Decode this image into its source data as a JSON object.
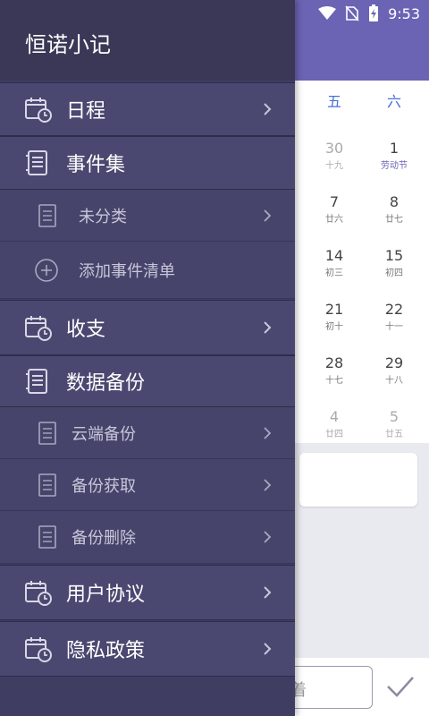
{
  "status": {
    "time": "9:53"
  },
  "calendar": {
    "weekdays": [
      "五",
      "六"
    ],
    "rows": [
      [
        {
          "d": "30",
          "l": "十九"
        },
        {
          "d": "1",
          "l": "劳动节"
        }
      ],
      [
        {
          "d": "7",
          "l": "廿六"
        },
        {
          "d": "8",
          "l": "廿七"
        }
      ],
      [
        {
          "d": "14",
          "l": "初三"
        },
        {
          "d": "15",
          "l": "初四"
        }
      ],
      [
        {
          "d": "21",
          "l": "初十"
        },
        {
          "d": "22",
          "l": "十一"
        }
      ],
      [
        {
          "d": "28",
          "l": "十七"
        },
        {
          "d": "29",
          "l": "十八"
        }
      ],
      [
        {
          "d": "4",
          "l": "廿四"
        },
        {
          "d": "5",
          "l": "廿五"
        }
      ]
    ]
  },
  "bottom": {
    "input_partial": "着"
  },
  "drawer": {
    "title": "恒诺小记",
    "items": {
      "schedule": "日程",
      "event_set": "事件集",
      "uncategorized": "未分类",
      "add_list": "添加事件清单",
      "income_expense": "收支",
      "data_backup": "数据备份",
      "cloud_backup": "云端备份",
      "backup_fetch": "备份获取",
      "backup_delete": "备份删除",
      "user_agreement": "用户协议",
      "privacy_policy": "隐私政策"
    }
  },
  "colors": {
    "accent": "#6b63b3",
    "drawer": "#3f3d61"
  }
}
